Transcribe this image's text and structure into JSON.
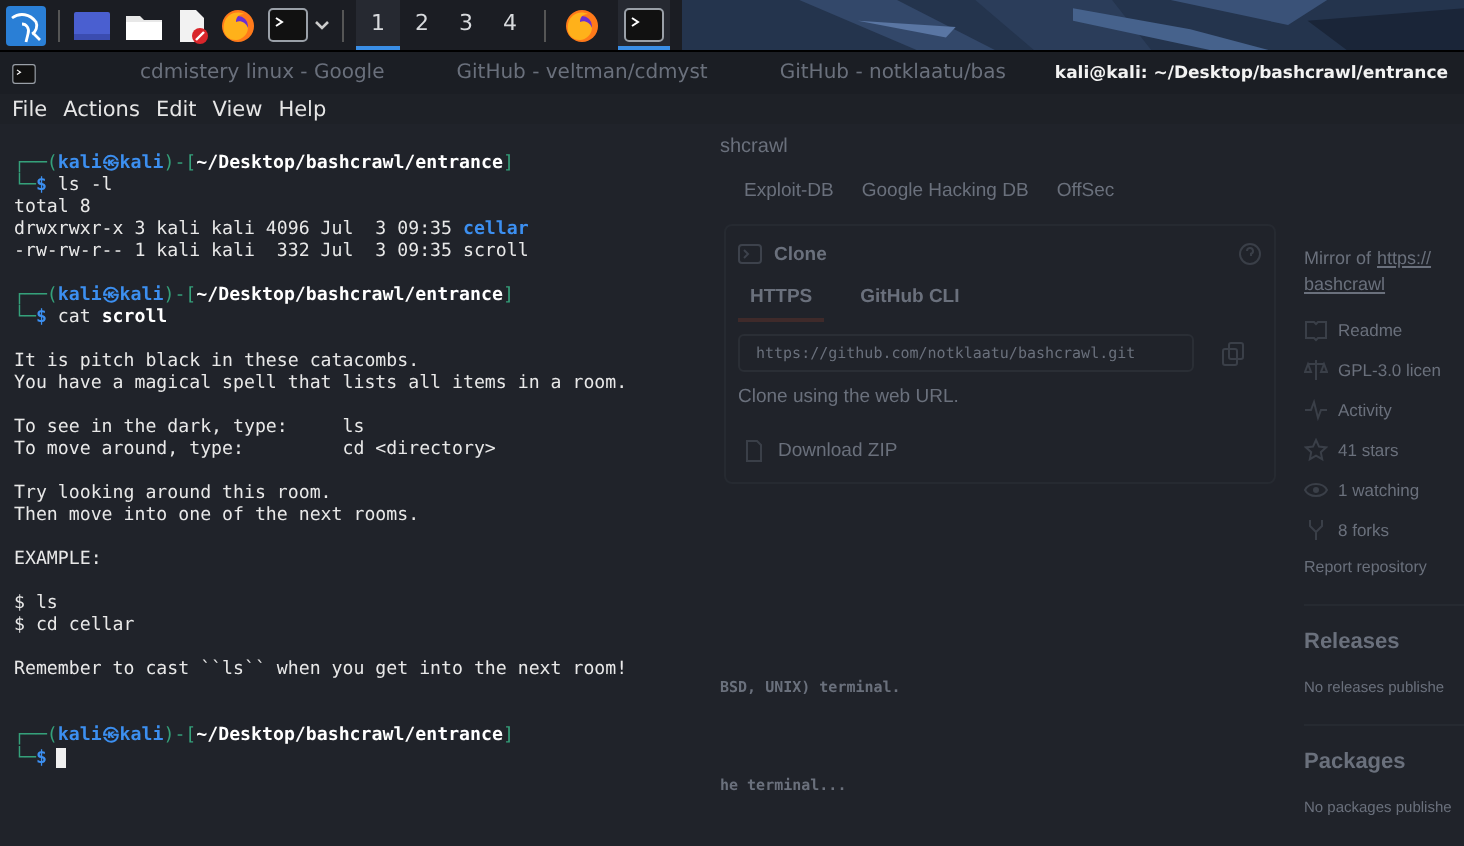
{
  "taskbar": {
    "launchers": [
      {
        "kind": "kali"
      },
      {
        "kind": "desktop"
      },
      {
        "kind": "files"
      },
      {
        "kind": "editor"
      },
      {
        "kind": "firefox"
      },
      {
        "kind": "terminal"
      }
    ],
    "workspaces": [
      {
        "label": "1",
        "selected": true
      },
      {
        "label": "2",
        "selected": false
      },
      {
        "label": "3",
        "selected": false
      },
      {
        "label": "4",
        "selected": false
      }
    ],
    "apps": [
      {
        "kind": "firefox",
        "active": false
      },
      {
        "kind": "terminal",
        "active": true
      }
    ]
  },
  "window": {
    "title": "kali@kali: ~/Desktop/bashcrawl/entrance"
  },
  "menu": [
    "File",
    "Actions",
    "Edit",
    "View",
    "Help"
  ],
  "terminal": {
    "lines": [
      {
        "kind": "text",
        "segments": [
          {
            "text": "┌──(",
            "kind": "frame"
          },
          {
            "text": "kali㉿kali",
            "kind": "user"
          },
          {
            "text": ")-[",
            "kind": "frame"
          },
          {
            "text": "~/Desktop/bashcrawl/entrance",
            "kind": "path"
          },
          {
            "text": "]",
            "kind": "frame"
          }
        ]
      },
      {
        "kind": "text",
        "segments": [
          {
            "text": "└─",
            "kind": "frame"
          },
          {
            "text": "$",
            "kind": "user"
          },
          {
            "text": " ls -l",
            "kind": "plain"
          }
        ]
      },
      {
        "kind": "text",
        "segments": [
          {
            "text": "total 8",
            "kind": "plain"
          }
        ]
      },
      {
        "kind": "text",
        "segments": [
          {
            "text": "drwxrwxr-x 3 kali kali 4096 Jul  3 09:35 ",
            "kind": "plain"
          },
          {
            "text": "cellar",
            "kind": "dir"
          }
        ]
      },
      {
        "kind": "text",
        "segments": [
          {
            "text": "-rw-rw-r-- 1 kali kali  332 Jul  3 09:35 scroll",
            "kind": "plain"
          }
        ]
      },
      {
        "kind": "blank"
      },
      {
        "kind": "text",
        "segments": [
          {
            "text": "┌──(",
            "kind": "frame"
          },
          {
            "text": "kali㉿kali",
            "kind": "user"
          },
          {
            "text": ")-[",
            "kind": "frame"
          },
          {
            "text": "~/Desktop/bashcrawl/entrance",
            "kind": "path"
          },
          {
            "text": "]",
            "kind": "frame"
          }
        ]
      },
      {
        "kind": "text",
        "segments": [
          {
            "text": "└─",
            "kind": "frame"
          },
          {
            "text": "$",
            "kind": "user"
          },
          {
            "text": " cat ",
            "kind": "plain"
          },
          {
            "text": "scroll",
            "kind": "bold"
          }
        ]
      },
      {
        "kind": "blank"
      },
      {
        "kind": "text",
        "segments": [
          {
            "text": "It is pitch black in these catacombs.",
            "kind": "plain"
          }
        ]
      },
      {
        "kind": "text",
        "segments": [
          {
            "text": "You have a magical spell that lists all items in a room.",
            "kind": "plain"
          }
        ]
      },
      {
        "kind": "blank"
      },
      {
        "kind": "text",
        "segments": [
          {
            "text": "To see in the dark, type:     ls",
            "kind": "plain"
          }
        ]
      },
      {
        "kind": "text",
        "segments": [
          {
            "text": "To move around, type:         cd <directory>",
            "kind": "plain"
          }
        ]
      },
      {
        "kind": "blank"
      },
      {
        "kind": "text",
        "segments": [
          {
            "text": "Try looking around this room.",
            "kind": "plain"
          }
        ]
      },
      {
        "kind": "text",
        "segments": [
          {
            "text": "Then move into one of the next rooms.",
            "kind": "plain"
          }
        ]
      },
      {
        "kind": "blank"
      },
      {
        "kind": "text",
        "segments": [
          {
            "text": "EXAMPLE:",
            "kind": "plain"
          }
        ]
      },
      {
        "kind": "blank"
      },
      {
        "kind": "text",
        "segments": [
          {
            "text": "$ ls",
            "kind": "plain"
          }
        ]
      },
      {
        "kind": "text",
        "segments": [
          {
            "text": "$ cd cellar",
            "kind": "plain"
          }
        ]
      },
      {
        "kind": "blank"
      },
      {
        "kind": "text",
        "segments": [
          {
            "text": "Remember to cast ``ls`` when you get into the next room!",
            "kind": "plain"
          }
        ]
      },
      {
        "kind": "blank"
      },
      {
        "kind": "blank"
      },
      {
        "kind": "text",
        "segments": [
          {
            "text": "┌──(",
            "kind": "frame"
          },
          {
            "text": "kali㉿kali",
            "kind": "user"
          },
          {
            "text": ")-[",
            "kind": "frame"
          },
          {
            "text": "~/Desktop/bashcrawl/entrance",
            "kind": "path"
          },
          {
            "text": "]",
            "kind": "frame"
          }
        ]
      },
      {
        "kind": "text",
        "segments": [
          {
            "text": "└─",
            "kind": "frame"
          },
          {
            "text": "$",
            "kind": "user"
          },
          {
            "kind": "cursor"
          }
        ]
      }
    ]
  },
  "background_page": {
    "tabs": [
      "cdmistery linux - Google",
      "GitHub - veltman/cdmyst",
      "GitHub - notklaatu/bas"
    ],
    "address": "shcrawl",
    "bookmarks": [
      "Exploit-DB",
      "Google Hacking DB",
      "OffSec"
    ],
    "clone_panel": {
      "title": "Clone",
      "tabs": [
        {
          "label": "HTTPS",
          "selected": true
        },
        {
          "label": "GitHub CLI",
          "selected": false
        }
      ],
      "url": "https://github.com/notklaatu/bashcrawl.git",
      "hint": "Clone using the web URL.",
      "download": "Download ZIP"
    },
    "readme_lines": [
      "BSD, UNIX) terminal.",
      "he terminal..."
    ],
    "sidebar": {
      "mirror_label": "Mirror of",
      "mirror_link": "https://",
      "repo_link": "bashcrawl",
      "stats": [
        {
          "kind": "book",
          "label": "Readme"
        },
        {
          "kind": "scale",
          "label": "GPL-3.0 licen"
        },
        {
          "kind": "pulse",
          "label": "Activity"
        },
        {
          "kind": "star",
          "label": "41 stars"
        },
        {
          "kind": "eye",
          "label": "1 watching"
        },
        {
          "kind": "fork",
          "label": "8 forks"
        }
      ],
      "report": "Report repository",
      "sections": [
        {
          "heading": "Releases",
          "note": "No releases publishe"
        },
        {
          "heading": "Packages",
          "note": "No packages publishe"
        }
      ]
    }
  }
}
